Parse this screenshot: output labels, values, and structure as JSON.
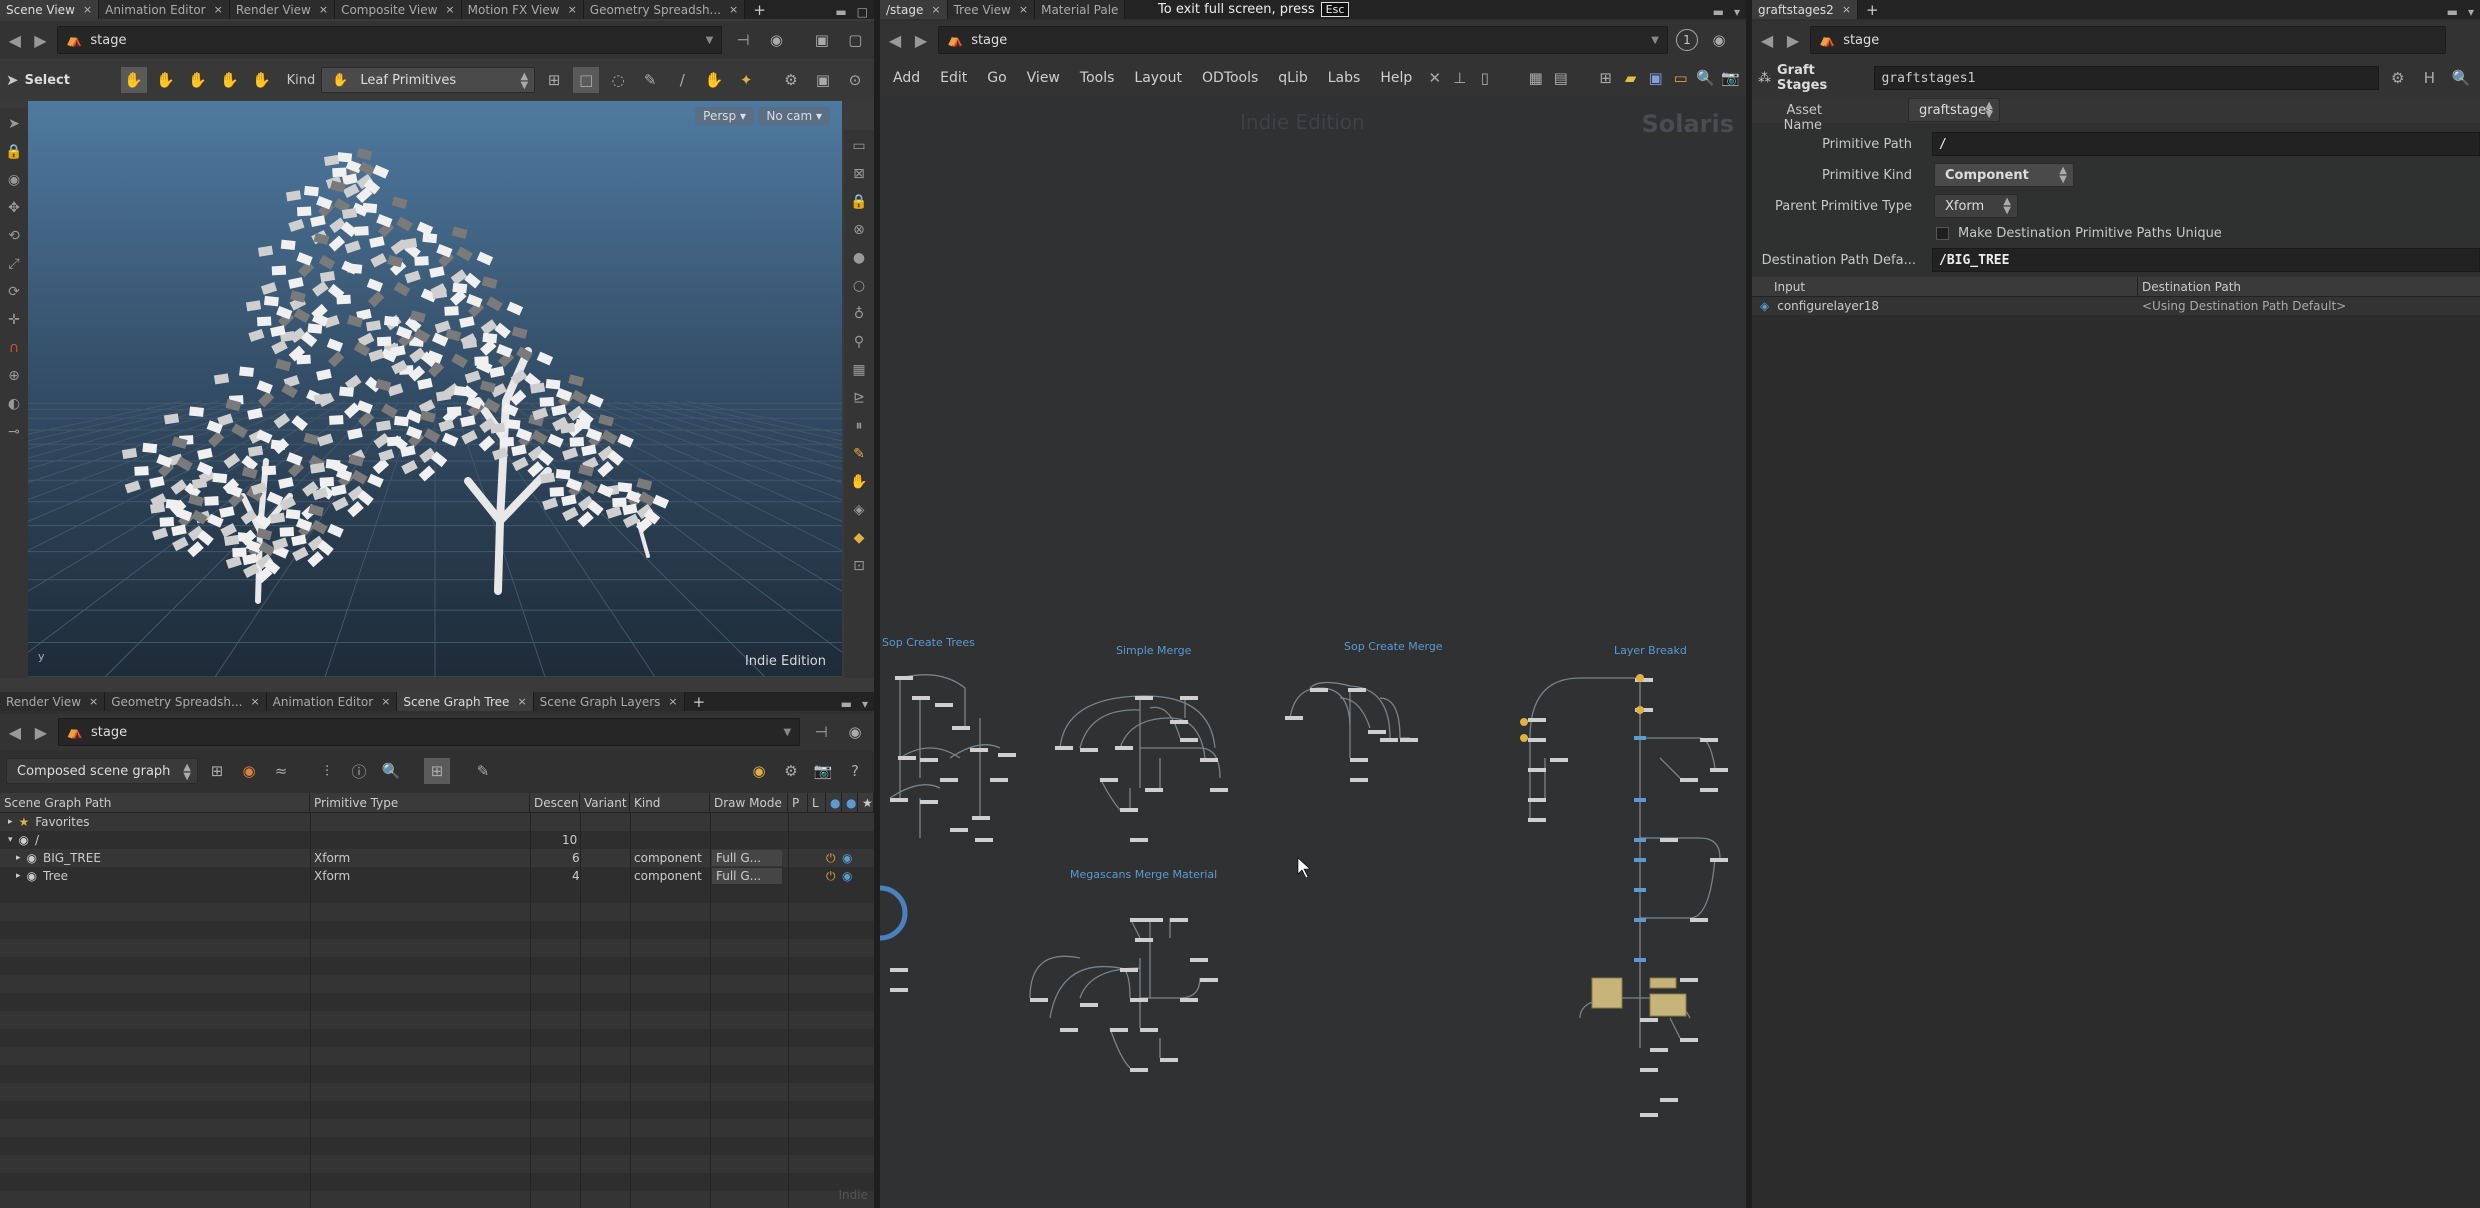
{
  "fullscreen_notice": {
    "text": "To exit full screen, press",
    "key": "Esc"
  },
  "left_top": {
    "tabs": [
      "Scene View",
      "Animation Editor",
      "Render View",
      "Composite View",
      "Motion FX View",
      "Geometry Spreadsh..."
    ],
    "active_tab": 0,
    "path": "stage",
    "select_label": "Select",
    "kind_label": "Kind",
    "kind_value": "Leaf Primitives",
    "cam_persp": "Persp",
    "cam_nocam": "No cam",
    "watermark": "Indie Edition"
  },
  "left_bottom": {
    "tabs": [
      "Render View",
      "Geometry Spreadsh...",
      "Animation Editor",
      "Scene Graph Tree",
      "Scene Graph Layers"
    ],
    "active_tab": 3,
    "path": "stage",
    "mode": "Composed scene graph",
    "columns": [
      "Scene Graph Path",
      "Primitive Type",
      "Descen",
      "Variant",
      "Kind",
      "Draw Mode",
      "P",
      "L"
    ],
    "favorites_label": "Favorites",
    "root_row": {
      "path": "/",
      "count": "10"
    },
    "rows": [
      {
        "path": "BIG_TREE",
        "type": "Xform",
        "count": "6",
        "kind": "component",
        "draw": "Full G..."
      },
      {
        "path": "Tree",
        "type": "Xform",
        "count": "4",
        "kind": "component",
        "draw": "Full G..."
      }
    ],
    "watermark": "Indie"
  },
  "network": {
    "tabs": [
      "/stage",
      "Tree View",
      "Material Pale"
    ],
    "active_tab": 0,
    "path": "stage",
    "menus": [
      "Add",
      "Edit",
      "Go",
      "View",
      "Tools",
      "Layout",
      "ODTools",
      "qLib",
      "Labs",
      "Help"
    ],
    "watermark": "Indie Edition",
    "context_label": "Solaris",
    "page_num": "1",
    "node_groups": [
      "Sop Create Trees",
      "Simple Merge",
      "Sop Create Merge",
      "Layer Breakd",
      "Megascans Merge Material"
    ]
  },
  "params": {
    "tabs": [
      "graftstages2"
    ],
    "active_tab": 0,
    "path": "stage",
    "node_type": "Graft Stages",
    "node_name": "graftstages1",
    "asset_name_label": "Asset Name",
    "asset_name_value": "graftstages",
    "primitive_path_label": "Primitive Path",
    "primitive_path_value": "/",
    "primitive_kind_label": "Primitive Kind",
    "primitive_kind_value": "Component",
    "parent_type_label": "Parent Primitive Type",
    "parent_type_value": "Xform",
    "unique_checkbox_label": "Make Destination Primitive Paths Unique",
    "dest_default_label": "Destination Path Defa...",
    "dest_default_value": "/BIG_TREE",
    "table_columns": [
      "Input",
      "Destination Path"
    ],
    "table_rows": [
      {
        "input": "configurelayer18",
        "dest": "<Using Destination Path Default>"
      }
    ]
  }
}
